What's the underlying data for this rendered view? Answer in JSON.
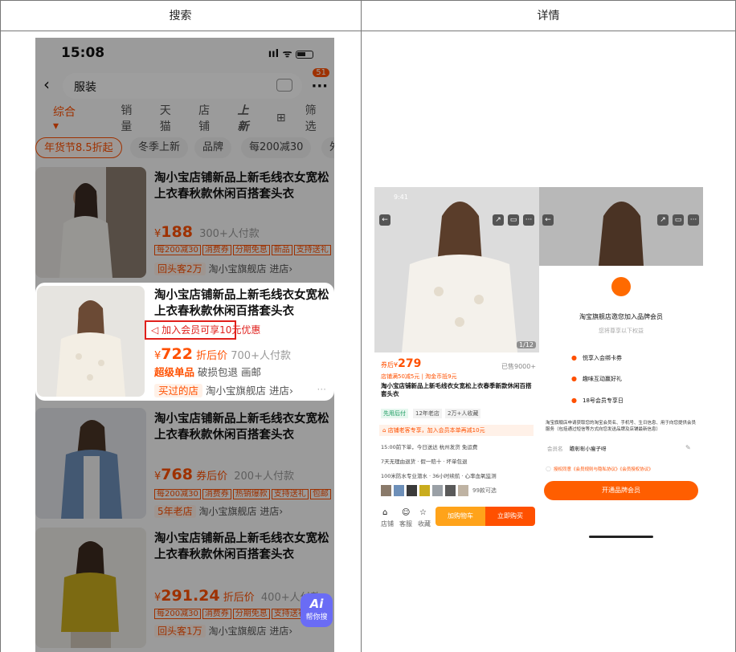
{
  "table": {
    "col_search": "搜索",
    "col_detail": "详情"
  },
  "left": {
    "status_time": "15:08",
    "status_icons": "ııl ᯤ",
    "search_query": "服装",
    "cart_badge": "51",
    "filters": {
      "comprehensive": "综合",
      "comprehensive_arrow": "▾",
      "sales": "销量",
      "tmall": "天猫",
      "store": "店铺",
      "new": "上新",
      "filter": "筛选"
    },
    "tags": [
      "年货节8.5折起",
      "冬季上新",
      "品牌",
      "每200减30",
      "外"
    ],
    "products": [
      {
        "title": "淘小宝店铺新品上新毛线衣女宽松上衣春秋款休闲百搭套头衣",
        "price": "188",
        "price_prefix": "¥",
        "price_sub": "300+人付款",
        "badges": [
          "每200减30",
          "消费券",
          "分期免息",
          "新品",
          "支持送礼"
        ],
        "shop_tag": "回头客2万",
        "shop_name": "淘小宝旗舰店",
        "shop_link": "进店",
        "shop_arrow": "›"
      },
      {
        "title": "淘小宝店铺新品上新毛线衣女宽松上衣春秋款休闲百搭套头衣",
        "vip_text": "加入会员可享10元优惠",
        "price": "722",
        "price_prefix": "¥",
        "price_label": "折后价",
        "price_sub": "700+人付款",
        "super": "超级单品",
        "service": "破损包退",
        "service2": "画邮",
        "shop_tag": "买过的店",
        "shop_name": "淘小宝旗舰店",
        "shop_link": "进店",
        "shop_arrow": "›"
      },
      {
        "title": "淘小宝店铺新品上新毛线衣女宽松上衣春秋款休闲百搭套头衣",
        "price": "768",
        "price_prefix": "¥",
        "price_label": "券后价",
        "price_sub": "200+人付款",
        "badges": [
          "每200减30",
          "消费券",
          "热销爆款",
          "支持送礼",
          "包邮"
        ],
        "shop_tag": "5年老店",
        "shop_name": "淘小宝旗舰店",
        "shop_link": "进店",
        "shop_arrow": "›"
      },
      {
        "title": "淘小宝店铺新品上新毛线衣女宽松上衣春秋款休闲百搭套头衣",
        "price": "291.24",
        "price_prefix": "¥",
        "price_label": "折后价",
        "price_sub": "400+人付款",
        "badges": [
          "每200减30",
          "消费券",
          "分期免息",
          "支持送礼"
        ],
        "shop_tag": "回头客1万",
        "shop_name": "淘小宝旗舰店",
        "shop_link": "进店",
        "shop_arrow": "›"
      }
    ],
    "ai_label": "Ai",
    "ai_sub": "帮你搜"
  },
  "detail": {
    "status_time": "9:41",
    "img_counter": "1/12",
    "price_label": "券后¥",
    "price": "279",
    "sold": "已售9000+",
    "promo": "店铺满50减5元 | 淘金币抵9元",
    "title": "淘小宝店铺新品上新毛线衣女宽松上衣春季新款休闲百搭套头衣",
    "tags": [
      "先用后付",
      "12年老店",
      "2万+人收藏"
    ],
    "notice": "店铺老客专享，加入会员本单再减10元",
    "ship": "15:00前下单，今日送达  杭州发货 免运费",
    "guarantee": "7天无理由退货 · 假一赔十 · 坏单包退",
    "material": "100米防水专业潜水 · 36小时续航 · 心率血氧监测",
    "variants": "99款可选",
    "nav": [
      "店铺",
      "客服",
      "收藏"
    ],
    "cart_btn": "加购物车",
    "buy_btn": "立即购买"
  },
  "modal": {
    "title": "淘宝旗舰店邀您加入品牌会员",
    "subtitle": "您将尊享以下权益",
    "benefits": [
      "悦享入会绑卡券",
      "趣味互动赢好礼",
      "18号会员专享日"
    ],
    "consent": "淘宝旗舰店申请获取您的淘宝会员名、手机号、生日信息、用于向您提供会员服务（包括通过短信等方式向您发送品牌及店铺最新信息）",
    "member_label": "会员名",
    "member_name": "瞻彰彰小瘦子呀",
    "agreement": "授权同意《会员规则与隐私协议》《会员授权协议》",
    "join_btn": "开通品牌会员"
  },
  "colors": {
    "accent": "#ff5000",
    "highlight_border": "#e0201c"
  }
}
